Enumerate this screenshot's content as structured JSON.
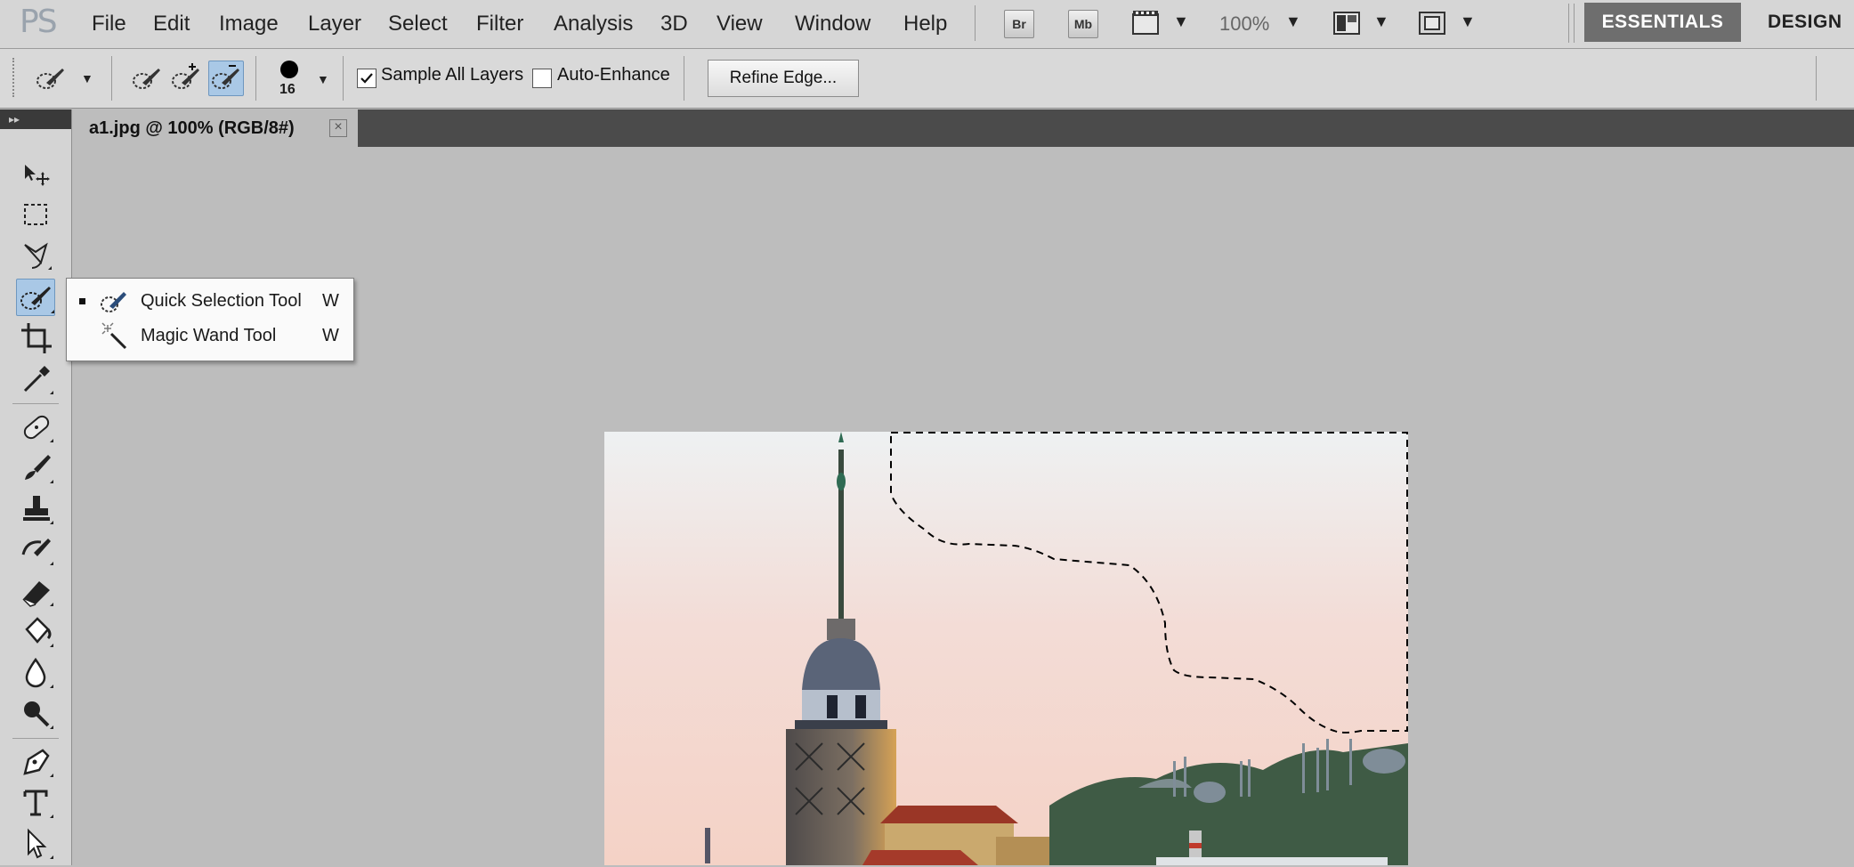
{
  "app": {
    "logo": "PS",
    "menu": [
      "File",
      "Edit",
      "Image",
      "Layer",
      "Select",
      "Filter",
      "Analysis",
      "3D",
      "View",
      "Window",
      "Help"
    ],
    "bridge_label": "Br",
    "minibridge_label": "Mb",
    "zoom": "100%",
    "workspaces": {
      "essentials": "ESSENTIALS",
      "design": "DESIGN"
    }
  },
  "options": {
    "brush_size": "16",
    "sample_all_layers": {
      "label": "Sample All Layers",
      "checked": true
    },
    "auto_enhance": {
      "label": "Auto-Enhance",
      "checked": false
    },
    "refine_edge": "Refine Edge..."
  },
  "document": {
    "tab_title": "a1.jpg @ 100% (RGB/8#)",
    "close_glyph": "×"
  },
  "flyout": {
    "items": [
      {
        "label": "Quick Selection Tool",
        "shortcut": "W",
        "selected": true
      },
      {
        "label": "Magic Wand Tool",
        "shortcut": "W",
        "selected": false
      }
    ]
  },
  "icons": {
    "tools": [
      "move-icon",
      "marquee-icon",
      "lasso-icon",
      "quick-selection-icon",
      "crop-icon",
      "eyedropper-icon",
      "healing-icon",
      "brush-icon",
      "stamp-icon",
      "history-brush-icon",
      "eraser-icon",
      "paint-bucket-icon",
      "blur-icon",
      "dodge-icon",
      "pen-icon",
      "type-icon",
      "path-selection-icon"
    ]
  },
  "colors": {
    "accent_selected": "#a9c8e6",
    "essentials_bg": "#6e6e6e",
    "workspace_bg": "#bdbdbd"
  }
}
